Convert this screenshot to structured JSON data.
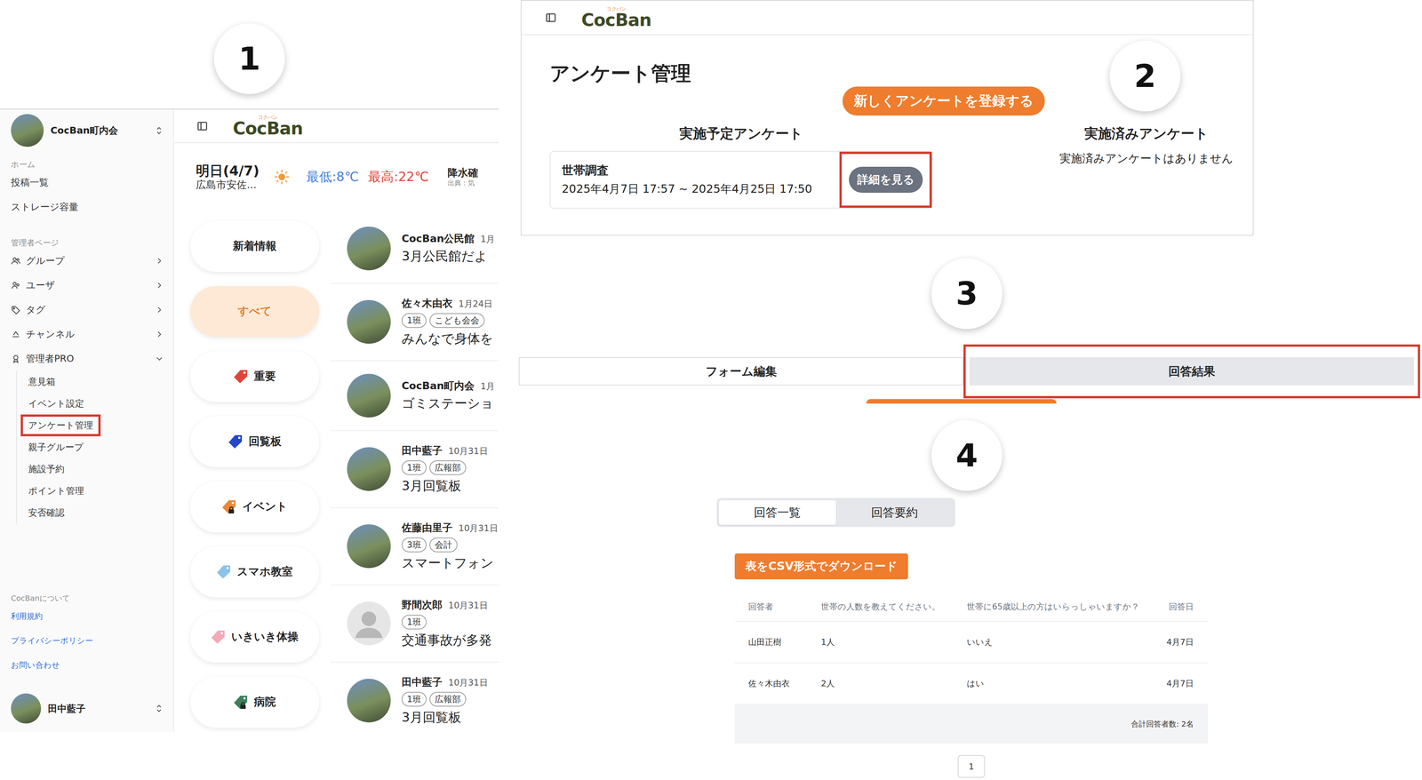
{
  "markers": [
    "1",
    "2",
    "3",
    "4"
  ],
  "app": {
    "logo": {
      "text": "CocBan",
      "ruby": "コクバン"
    },
    "sidebar": {
      "org": "CocBan町内会",
      "home": {
        "label": "ホーム",
        "items": [
          "投稿一覧",
          "ストレージ容量"
        ]
      },
      "admin": {
        "label": "管理者ページ",
        "items": [
          {
            "label": "グループ",
            "expanded": false,
            "children": []
          },
          {
            "label": "ユーザ",
            "expanded": false,
            "children": []
          },
          {
            "label": "タグ",
            "expanded": false,
            "children": []
          },
          {
            "label": "チャンネル",
            "expanded": false,
            "children": []
          },
          {
            "label": "管理者PRO",
            "expanded": true,
            "children": [
              {
                "label": "意見箱",
                "highlighted": false
              },
              {
                "label": "イベント設定",
                "highlighted": false
              },
              {
                "label": "アンケート管理",
                "highlighted": true
              },
              {
                "label": "親子グループ",
                "highlighted": false
              },
              {
                "label": "施設予約",
                "highlighted": false
              },
              {
                "label": "ポイント管理",
                "highlighted": false
              },
              {
                "label": "安否確認",
                "highlighted": false
              }
            ]
          }
        ]
      },
      "about": {
        "label": "CocBanについて",
        "links": [
          "利用規約",
          "プライバシーポリシー",
          "お問い合わせ"
        ]
      },
      "user": "田中藍子"
    },
    "weather": {
      "day": "明日(4/7)",
      "place": "広島市安佐...",
      "low": "最低:8℃",
      "high": "最高:22℃",
      "rain": "降水確",
      "source": "出典：気"
    },
    "filters": [
      {
        "label": "新着情報",
        "kind": "plain",
        "selected": false,
        "locked": false
      },
      {
        "label": "すべて",
        "kind": "plain",
        "selected": true,
        "locked": false
      },
      {
        "label": "重要",
        "kind": "tag",
        "selected": false,
        "locked": false,
        "color": "#e0453a"
      },
      {
        "label": "回覧板",
        "kind": "tag",
        "selected": false,
        "locked": false,
        "color": "#2546c9"
      },
      {
        "label": "イベント",
        "kind": "tag",
        "selected": false,
        "locked": true,
        "color": "#e8893a"
      },
      {
        "label": "スマホ教室",
        "kind": "tag",
        "selected": false,
        "locked": false,
        "color": "#8cc3ea"
      },
      {
        "label": "いきいき体操",
        "kind": "tag",
        "selected": false,
        "locked": false,
        "color": "#f2a9b8"
      },
      {
        "label": "病院",
        "kind": "tag",
        "selected": false,
        "locked": true,
        "color": "#3f7f5a"
      }
    ],
    "posts": [
      {
        "author": "CocBan公民館",
        "date": "1月",
        "tags": [],
        "title": "3月公民館だよ",
        "avatar": "photo"
      },
      {
        "author": "佐々木由衣",
        "date": "1月24日",
        "tags": [
          "1班",
          "こども会会"
        ],
        "title": "みんなで身体を",
        "avatar": "photo"
      },
      {
        "author": "CocBan町内会",
        "date": "1月",
        "tags": [],
        "title": "ゴミステーショ",
        "avatar": "photo"
      },
      {
        "author": "田中藍子",
        "date": "10月31日",
        "tags": [
          "1班",
          "広報部"
        ],
        "title": "3月回覧板",
        "avatar": "photo"
      },
      {
        "author": "佐藤由里子",
        "date": "10月31日",
        "tags": [
          "3班",
          "会計"
        ],
        "title": "スマートフォン",
        "avatar": "photo"
      },
      {
        "author": "野間次郎",
        "date": "10月31日",
        "tags": [
          "1班"
        ],
        "title": "交通事故が多発",
        "avatar": "default"
      },
      {
        "author": "田中藍子",
        "date": "10月31日",
        "tags": [
          "1班",
          "広報部"
        ],
        "title": "3月回覧板",
        "avatar": "photo"
      }
    ]
  },
  "survey_admin": {
    "logo": {
      "text": "CocBan",
      "ruby": "コクバン"
    },
    "title": "アンケート管理",
    "new_button": "新しくアンケートを登録する",
    "scheduled": {
      "heading": "実施予定アンケート",
      "items": [
        {
          "name": "世帯調査",
          "period": "2025年4月7日 17:57 ~ 2025年4月25日 17:50",
          "button": "詳細を見る",
          "highlighted": true
        }
      ]
    },
    "completed": {
      "heading": "実施済みアンケート",
      "empty": "実施済みアンケートはありません"
    }
  },
  "survey_tabs": [
    {
      "label": "フォーム編集",
      "selected": false,
      "highlighted": false
    },
    {
      "label": "回答結果",
      "selected": true,
      "highlighted": true
    }
  ],
  "results": {
    "tabs": [
      {
        "label": "回答一覧",
        "selected": true
      },
      {
        "label": "回答要約",
        "selected": false
      }
    ],
    "csv_button": "表をCSV形式でダウンロード",
    "columns": [
      "回答者",
      "世帯の人数を教えてください。",
      "世帯に65歳以上の方はいらっしゃいますか？",
      "回答日"
    ],
    "rows": [
      [
        "山田正樹",
        "1人",
        "いいえ",
        "4月7日"
      ],
      [
        "佐々木由衣",
        "2人",
        "はい",
        "4月7日"
      ]
    ],
    "total": "合計回答者数: 2名",
    "pages": [
      {
        "label": "1",
        "selected": true
      }
    ]
  }
}
